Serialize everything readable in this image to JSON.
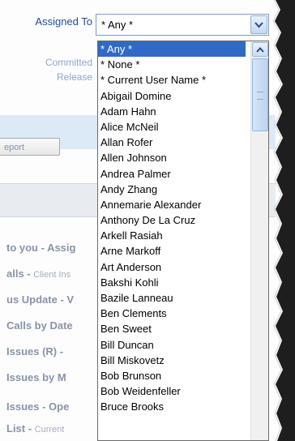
{
  "form": {
    "assigned_to_label": "Assigned To",
    "committed_label": "Committed",
    "release_label": "Release",
    "report_button": "eport"
  },
  "select": {
    "value": "* Any *",
    "options": [
      "* Any *",
      "* None *",
      "* Current User Name *",
      "Abigail Domine",
      "Adam Hahn",
      "Alice McNeil",
      "Allan Rofer",
      "Allen Johnson",
      "Andrea Palmer",
      "Andy Zhang",
      "Annemarie Alexander",
      "Anthony De La Cruz",
      "Arkell Rasiah",
      "Arne Markoff",
      "Art Anderson",
      "Bakshi Kohli",
      "Bazile Lanneau",
      "Ben Clements",
      "Ben Sweet",
      "Bill Duncan",
      "Bill Miskovetz",
      "Bob Brunson",
      "Bob Weidenfeller",
      "Bruce Brooks"
    ]
  },
  "background_items": [
    {
      "bold": "to you - Assig",
      "dim": ""
    },
    {
      "bold": "alls - ",
      "dim": "Client Ins"
    },
    {
      "bold": "us Update - V",
      "dim": ""
    },
    {
      "bold": "Calls by Date",
      "dim": ""
    },
    {
      "bold": "Issues (R) - ",
      "dim": ""
    },
    {
      "bold": "Issues by M",
      "dim": ""
    },
    {
      "bold": "Issues - Ope",
      "dim": ""
    },
    {
      "bold": "List - ",
      "dim": "Current"
    }
  ],
  "colors": {
    "selection": "#316ac5",
    "label_blue": "#1f4e9a"
  }
}
